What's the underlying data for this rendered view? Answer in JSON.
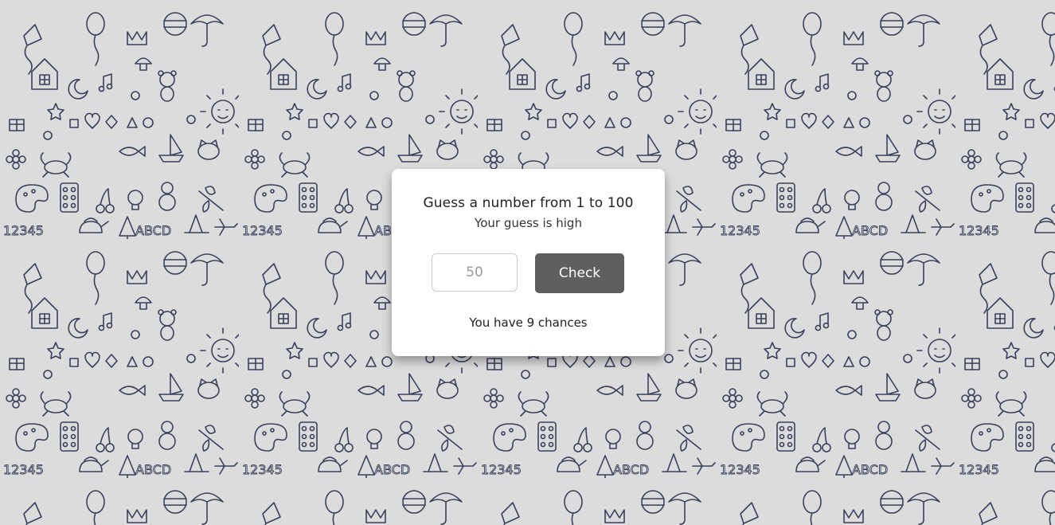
{
  "game": {
    "title": "Guess a number from 1 to 100",
    "status": "Your guess is high",
    "guess_placeholder": "50",
    "guess_value": "",
    "check_label": "Check",
    "chances_text": "You have 9 chances"
  },
  "background": {
    "pattern": "doodle-toys-pattern",
    "base_color": "#dcdcdc",
    "ink_color": "#3a3f5c",
    "doodle_text_numbers": "12345",
    "doodle_text_letters": "ABCD"
  },
  "colors": {
    "card": "#ffffff",
    "button": "#5f5f5f",
    "button_text": "#ffffff"
  }
}
